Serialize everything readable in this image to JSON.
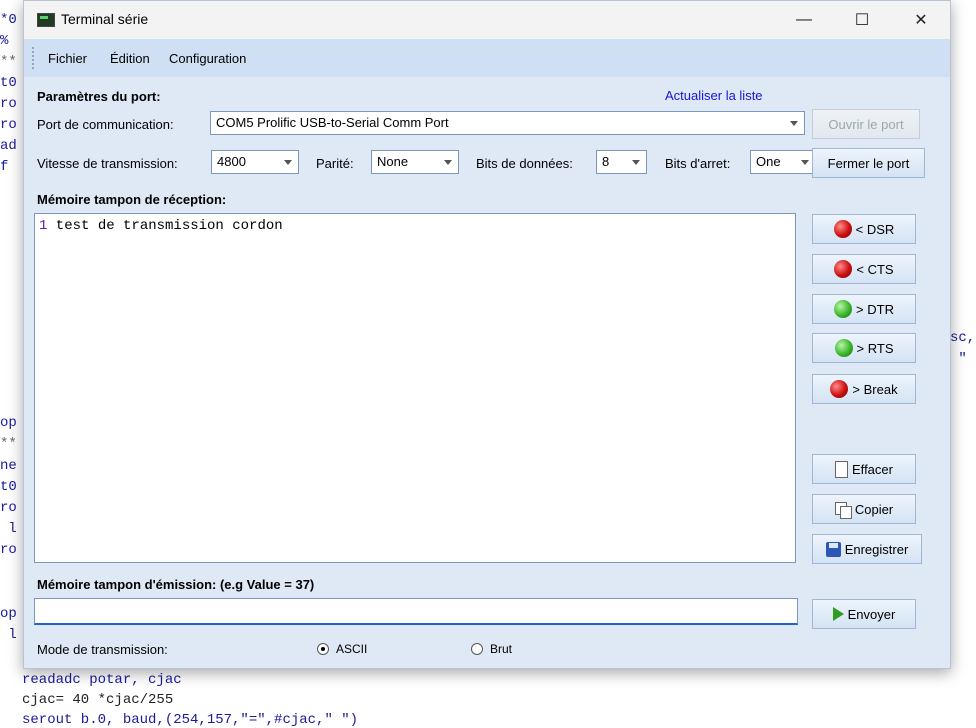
{
  "background_code": {
    "left_fragments": [
      "*0",
      "% ",
      "**",
      "t0",
      "ro",
      "ro",
      "ad",
      "f ",
      "op",
      "**",
      "ne",
      "t0",
      "ro",
      " l",
      "ro",
      "op",
      " l"
    ],
    "right_fragments": [
      "sc,",
      " \""
    ],
    "bottom_lines": [
      "readadc potar, cjac",
      "cjac= 40 *cjac/255",
      "serout b.0, baud,(254,157,\"=\",#cjac,\" \")"
    ]
  },
  "window": {
    "title": "Terminal série",
    "controls": {
      "minimize": "—",
      "maximize": "☐",
      "close": "✕"
    }
  },
  "menu": [
    "Fichier",
    "Édition",
    "Configuration"
  ],
  "port": {
    "section_title": "Paramètres du port:",
    "refresh_link": "Actualiser la liste",
    "comm_label": "Port de communication:",
    "comm_value": "COM5 Prolific USB-to-Serial Comm Port",
    "open_button": "Ouvrir le port",
    "speed_label": "Vitesse de transmission:",
    "speed_value": "4800",
    "parity_label": "Parité:",
    "parity_value": "None",
    "databits_label": "Bits de données:",
    "databits_value": "8",
    "stopbits_label": "Bits d'arret:",
    "stopbits_value": "One",
    "close_button": "Fermer le port"
  },
  "receive": {
    "title": "Mémoire tampon de réception:",
    "line_number": "1",
    "text": " test de transmission cordon"
  },
  "signals": [
    {
      "label": "< DSR",
      "state": "red"
    },
    {
      "label": "< CTS",
      "state": "red"
    },
    {
      "label": "> DTR",
      "state": "green"
    },
    {
      "label": "> RTS",
      "state": "green"
    },
    {
      "label": "> Break",
      "state": "red"
    }
  ],
  "actions": {
    "clear": "Effacer",
    "copy": "Copier",
    "save": "Enregistrer",
    "send": "Envoyer"
  },
  "send_buffer": {
    "title": "Mémoire tampon d'émission: (e.g Value = 37)",
    "value": ""
  },
  "mode": {
    "label": "Mode de transmission:",
    "options": [
      "ASCII",
      "Brut"
    ],
    "selected": "ASCII"
  }
}
